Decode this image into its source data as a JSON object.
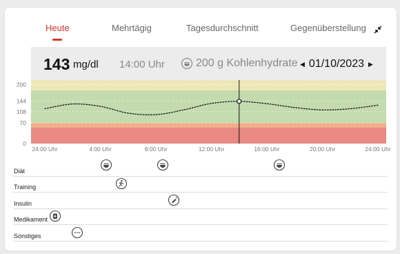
{
  "tabs": [
    {
      "label": "Heute",
      "active": true
    },
    {
      "label": "Mehrtägig",
      "active": false
    },
    {
      "label": "Tagesdurchschnitt",
      "active": false
    },
    {
      "label": "Gegenüberstellung",
      "active": false
    }
  ],
  "readout": {
    "value": "143",
    "unit": "mg/dl",
    "time": "14:00 Uhr",
    "carbs": "200 g Kohlenhydrate",
    "date": "01/10/2023"
  },
  "colors": {
    "accent": "#d6332e",
    "zone_high": "#ece8b6",
    "zone_target": "#c3dbae",
    "zone_low": "#f0ae88",
    "zone_very_low": "#e88a83"
  },
  "chart_data": {
    "type": "line",
    "title": "",
    "xlabel": "",
    "ylabel": "",
    "y_ticks": [
      "200",
      "144",
      "108",
      "70",
      "0"
    ],
    "x_ticks": [
      "24:00 Uhr",
      "4:00 Uhr",
      "8:00 Uhr",
      "12:00 Uhr",
      "16:00 Uhr",
      "20:00 Uhr",
      "24:00 Uhr"
    ],
    "series": [
      {
        "style": "dotted",
        "x_hours": [
          0,
          2,
          4,
          6,
          8,
          10,
          12,
          14,
          16,
          18,
          20,
          22,
          24
        ],
        "values": [
          118,
          134,
          126,
          103,
          98,
          114,
          136,
          143,
          135,
          122,
          114,
          118,
          130
        ]
      }
    ],
    "selected": {
      "x_hours": 14,
      "value": 143
    },
    "zones": [
      {
        "name": "high",
        "from": 180,
        "to": 215
      },
      {
        "name": "target",
        "from": 70,
        "to": 180
      },
      {
        "name": "low",
        "from": 54,
        "to": 70
      },
      {
        "name": "very_low",
        "from": 0,
        "to": 54
      }
    ],
    "grid": true
  },
  "events": {
    "rows": [
      {
        "label": "Diät",
        "icons": [
          {
            "type": "meal-icon",
            "hour": 4.4
          },
          {
            "type": "meal-icon",
            "hour": 8.5
          },
          {
            "type": "meal-icon",
            "hour": 16.9
          }
        ]
      },
      {
        "label": "Training",
        "icons": [
          {
            "type": "running-icon",
            "hour": 5.5
          }
        ]
      },
      {
        "label": "Insulin",
        "icons": [
          {
            "type": "insulin-pen-icon",
            "hour": 9.3
          }
        ]
      },
      {
        "label": "Medikament",
        "icons": [
          {
            "type": "medication-icon",
            "hour": null
          }
        ]
      },
      {
        "label": "Sonstiges",
        "icons": [
          {
            "type": "more-icon",
            "hour": null
          }
        ]
      }
    ]
  }
}
